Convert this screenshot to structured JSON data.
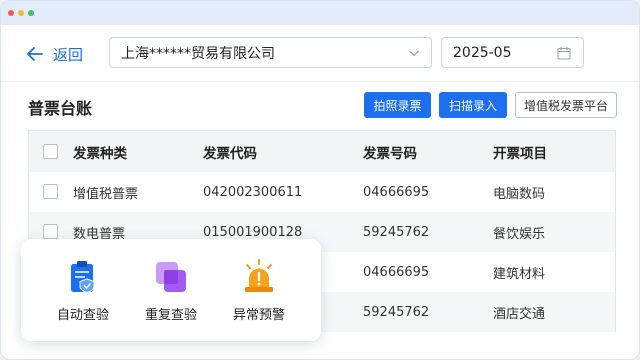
{
  "header": {
    "back_label": "返回",
    "company": "上海******贸易有限公司",
    "month": "2025-05"
  },
  "section": {
    "title": "普票台账",
    "buttons": {
      "photo_entry": "拍照录票",
      "scan_entry": "扫描录入",
      "vat_platform": "增值税发票平台"
    }
  },
  "table": {
    "headers": {
      "type": "发票种类",
      "code": "发票代码",
      "number": "发票号码",
      "item": "开票项目"
    },
    "rows": [
      {
        "type": "增值税普票",
        "code": "042002300611",
        "number": "04666695",
        "item": "电脑数码"
      },
      {
        "type": "数电普票",
        "code": "015001900128",
        "number": "59245762",
        "item": "餐饮娱乐"
      },
      {
        "type": "",
        "code": "",
        "number": "04666695",
        "item": "建筑材料"
      },
      {
        "type": "",
        "code": "",
        "number": "59245762",
        "item": "酒店交通"
      }
    ]
  },
  "popup": {
    "tools": {
      "auto_check": "自动查验",
      "repeat_check": "重复查验",
      "alert": "异常预警"
    }
  },
  "colors": {
    "accent": "#1b6ff0",
    "titlebar": "#e4ecfb",
    "alert_orange": "#f7a21b",
    "repeat_purple": "#a35cf0"
  },
  "icons": {
    "back": "arrow-left-icon",
    "dropdown": "chevron-down-icon",
    "calendar": "calendar-icon",
    "auto_check": "clipboard-shield-icon",
    "repeat_check": "stacked-squares-icon",
    "alert": "warning-beacon-icon"
  }
}
